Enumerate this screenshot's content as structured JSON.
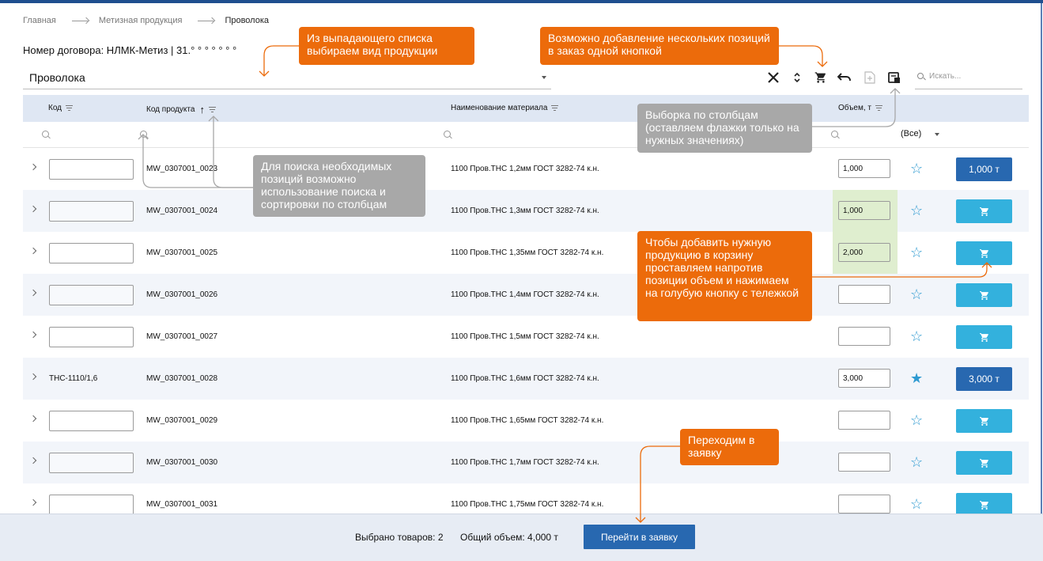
{
  "breadcrumb": {
    "items": [
      "Главная",
      "Метизная продукция"
    ],
    "current": "Проволока"
  },
  "contract": "Номер договора: НЛМК-Метиз | 31.° ° ° ° ° ° °",
  "product_select": {
    "value": "Проволока"
  },
  "toolbar": {
    "icons": [
      "close-icon",
      "expand-collapse-icon",
      "cart-add-all-icon",
      "undo-icon",
      "export-icon",
      "column-chooser-icon"
    ],
    "search_placeholder": "Искать..."
  },
  "table": {
    "headers": {
      "code": "Код",
      "product_code": "Код продукта",
      "name": "Наименование материала",
      "volume": "Объем, т"
    },
    "sort_indicator": "↑",
    "filter_all": "(Все)",
    "rows": [
      {
        "code": "",
        "product_code": "MW_0307001_0023",
        "name": "1100 Пров.ТНС 1,2мм ГОСТ 3282-74 к.н.",
        "volume": "1,000",
        "starred": false,
        "action": "1,000 т",
        "action_type": "done",
        "green": false
      },
      {
        "code": "",
        "product_code": "MW_0307001_0024",
        "name": "1100 Пров.ТНС 1,3мм ГОСТ 3282-74 к.н.",
        "volume": "1,000",
        "starred": false,
        "action": "",
        "action_type": "cart",
        "green": true
      },
      {
        "code": "",
        "product_code": "MW_0307001_0025",
        "name": "1100 Пров.ТНС 1,35мм ГОСТ 3282-74 к.н.",
        "volume": "2,000",
        "starred": false,
        "action": "",
        "action_type": "cart",
        "green": true
      },
      {
        "code": "",
        "product_code": "MW_0307001_0026",
        "name": "1100 Пров.ТНС 1,4мм ГОСТ 3282-74 к.н.",
        "volume": "",
        "starred": false,
        "action": "",
        "action_type": "cart",
        "green": false
      },
      {
        "code": "",
        "product_code": "MW_0307001_0027",
        "name": "1100 Пров.ТНС 1,5мм ГОСТ 3282-74 к.н.",
        "volume": "",
        "starred": false,
        "action": "",
        "action_type": "cart",
        "green": false
      },
      {
        "code": "ТНС-1110/1,6",
        "product_code": "MW_0307001_0028",
        "name": "1100 Пров.ТНС 1,6мм ГОСТ 3282-74 к.н.",
        "volume": "3,000",
        "starred": true,
        "action": "3,000 т",
        "action_type": "done",
        "green": false
      },
      {
        "code": "",
        "product_code": "MW_0307001_0029",
        "name": "1100 Пров.ТНС 1,65мм ГОСТ 3282-74 к.н.",
        "volume": "",
        "starred": false,
        "action": "",
        "action_type": "cart",
        "green": false
      },
      {
        "code": "",
        "product_code": "MW_0307001_0030",
        "name": "1100 Пров.ТНС 1,7мм ГОСТ 3282-74 к.н.",
        "volume": "",
        "starred": false,
        "action": "",
        "action_type": "cart",
        "green": false
      },
      {
        "code": "",
        "product_code": "MW_0307001_0031",
        "name": "1100 Пров.ТНС 1,75мм ГОСТ 3282-74 к.н.",
        "volume": "",
        "starred": false,
        "action": "",
        "action_type": "cart",
        "green": false
      }
    ]
  },
  "footer": {
    "selected": "Выбрано товаров: 2",
    "total": "Общий объем: 4,000 т",
    "go_button": "Перейти в заявку"
  },
  "callouts": {
    "select_product": "Из выпадающего списка выбираем вид продукции",
    "add_multiple": "Возможно добавление нескольких позиций в заказ одной кнопкой",
    "columns": "Выборка по столбцам (оставляем флажки только на нужных значениях)",
    "search_sort": "Для поиска необходимых позиций возможно использование поиска и сортировки по столбцам",
    "add_to_cart": "Чтобы добавить нужную продукцию в корзину проставляем напротив позиции объем и нажимаем на голубую кнопку с тележкой",
    "go_to_order": "Переходим в заявку"
  },
  "colors": {
    "accent": "#2868b0",
    "cart_button": "#33b1dd",
    "callout_orange": "#ec6b0b",
    "callout_gray": "#a8a8a8",
    "header_bg": "#dfe7f3",
    "highlight_green": "#dfeecf"
  }
}
